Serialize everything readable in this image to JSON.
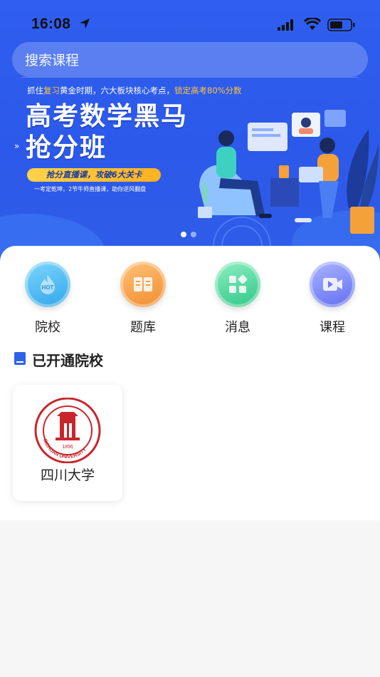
{
  "status_bar": {
    "time": "16:08"
  },
  "search": {
    "placeholder": "搜索课程"
  },
  "banner": {
    "tagline_pre": "抓住",
    "tagline_hl1": "复习",
    "tagline_mid1": "黄金时期",
    "tagline_mid2": "，六大板块核心考点，",
    "tagline_hl2": "锁定高考80%分数",
    "title_line1": "高考数学黑马",
    "title_line2": "抢分班",
    "pill": "抢分直播课，攻破6大关卡",
    "sub": "一考定乾坤，2节牛师直播课，助你逆风翻盘",
    "hot": "HOT"
  },
  "quick_nav": [
    {
      "label": "院校",
      "icon": "hot-flame-icon",
      "color": "#3fb6ee"
    },
    {
      "label": "题库",
      "icon": "book-open-icon",
      "color": "#f7a04a"
    },
    {
      "label": "消息",
      "icon": "grid-icon",
      "color": "#3ccf93"
    },
    {
      "label": "课程",
      "icon": "video-icon",
      "color": "#7b86f4"
    }
  ],
  "section": {
    "title": "已开通院校"
  },
  "schools": [
    {
      "name": "四川大学",
      "year": "1896",
      "seal_text": "SICHUAN UNIVERSITY"
    }
  ]
}
